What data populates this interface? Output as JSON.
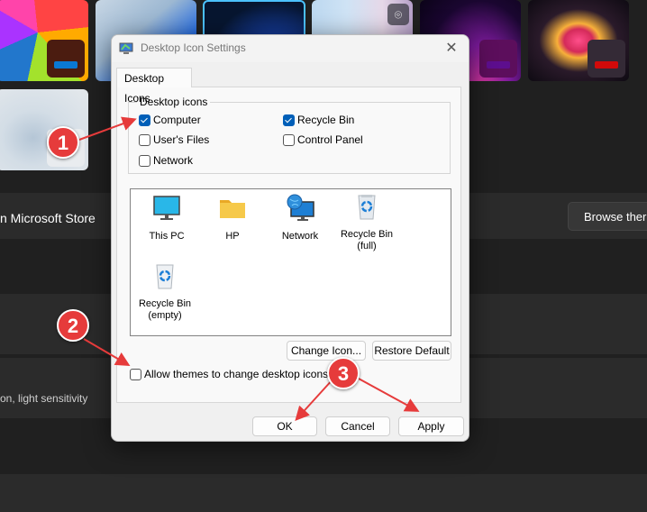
{
  "background": {
    "row_texts": {
      "store": "n Microsoft Store",
      "sensitivity": "on, light sensitivity"
    },
    "browse_button": "Browse ther",
    "thumbnail_icons": {
      "camera": "⌾"
    }
  },
  "dialog": {
    "title": "Desktop Icon Settings",
    "close_icon": "✕",
    "tab": "Desktop Icons",
    "group_label": "Desktop icons",
    "checkboxes": [
      {
        "label": "Computer",
        "checked": true
      },
      {
        "label": "Recycle Bin",
        "checked": true
      },
      {
        "label": "User's Files",
        "checked": false
      },
      {
        "label": "Control Panel",
        "checked": false
      },
      {
        "label": "Network",
        "checked": false
      }
    ],
    "icons": [
      {
        "label": "This PC",
        "icon": "monitor-icon"
      },
      {
        "label": "HP",
        "icon": "folder-icon"
      },
      {
        "label": "Network",
        "icon": "network-icon"
      },
      {
        "label": "Recycle Bin\n(full)",
        "line1": "Recycle Bin",
        "line2": "(full)",
        "icon": "recycle-bin-full-icon"
      },
      {
        "label": "Recycle Bin\n(empty)",
        "line1": "Recycle Bin",
        "line2": "(empty)",
        "icon": "recycle-bin-empty-icon"
      }
    ],
    "change_icon_button": "Change Icon...",
    "restore_default_button": "Restore Default",
    "allow_themes": {
      "label": "Allow themes to change desktop icons",
      "checked": false
    },
    "ok_button": "OK",
    "cancel_button": "Cancel",
    "apply_button": "Apply"
  },
  "annotations": {
    "markers": [
      "1",
      "2",
      "3"
    ],
    "color": "#e63b3b"
  },
  "colors": {
    "accent": "#005fb8",
    "page_bg": "#202020",
    "card_bg": "#2b2b2b"
  }
}
